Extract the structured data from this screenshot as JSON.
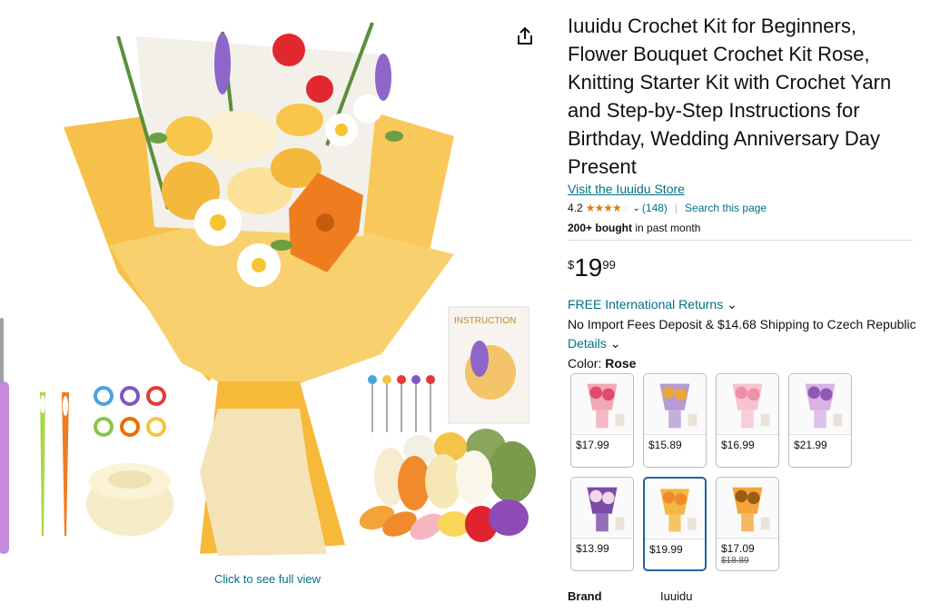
{
  "product": {
    "title": "Iuuidu Crochet Kit for Beginners, Flower Bouquet Crochet Kit Rose, Knitting Starter Kit with Crochet Yarn and Step-by-Step Instructions for Birthday, Wedding Anniversary Day Present",
    "store_link": "Visit the Iuuidu Store",
    "rating": "4.2",
    "rating_stars": 4.2,
    "rating_count": "(148)",
    "search_page": "Search this page",
    "bought_bold": "200+ bought",
    "bought_rest": " in past month",
    "price_symbol": "$",
    "price_whole": "19",
    "price_fraction": "99",
    "returns": "FREE International Returns",
    "shipping": "No Import Fees Deposit & $14.68 Shipping to Czech Republic",
    "details": "Details",
    "color_label": "Color: ",
    "color_value": "Rose",
    "brand_label": "Brand",
    "brand_value": "Iuuidu"
  },
  "gallery": {
    "full_view": "Click to see full view",
    "booklet_text": "INSTRUCTION"
  },
  "swatches": [
    {
      "price": "$17.99",
      "color": "#F2A7B5",
      "accent": "#E04A6E",
      "selected": false
    },
    {
      "price": "$15.89",
      "color": "#B69BD6",
      "accent": "#E9A93A",
      "selected": false
    },
    {
      "price": "$16.99",
      "color": "#F7C3CF",
      "accent": "#F08FA9",
      "selected": false
    },
    {
      "price": "$21.99",
      "color": "#D7B3E6",
      "accent": "#8E58B5",
      "selected": false
    },
    {
      "price": "$13.99",
      "color": "#7C4BA8",
      "accent": "#F3D6E8",
      "selected": false
    },
    {
      "price": "$19.99",
      "color": "#F4B740",
      "accent": "#F08A2C",
      "selected": true
    },
    {
      "price": "$17.09",
      "old_price": "$18.89",
      "color": "#F3A53A",
      "accent": "#9C5B16",
      "selected": false
    }
  ],
  "colors": {
    "link": "#007185",
    "star": "#E47911",
    "selected_border": "#2162A1",
    "wrap_paper": "#F7C04A"
  },
  "icons": [
    "share-icon",
    "star-icon",
    "chevron-down-icon"
  ]
}
